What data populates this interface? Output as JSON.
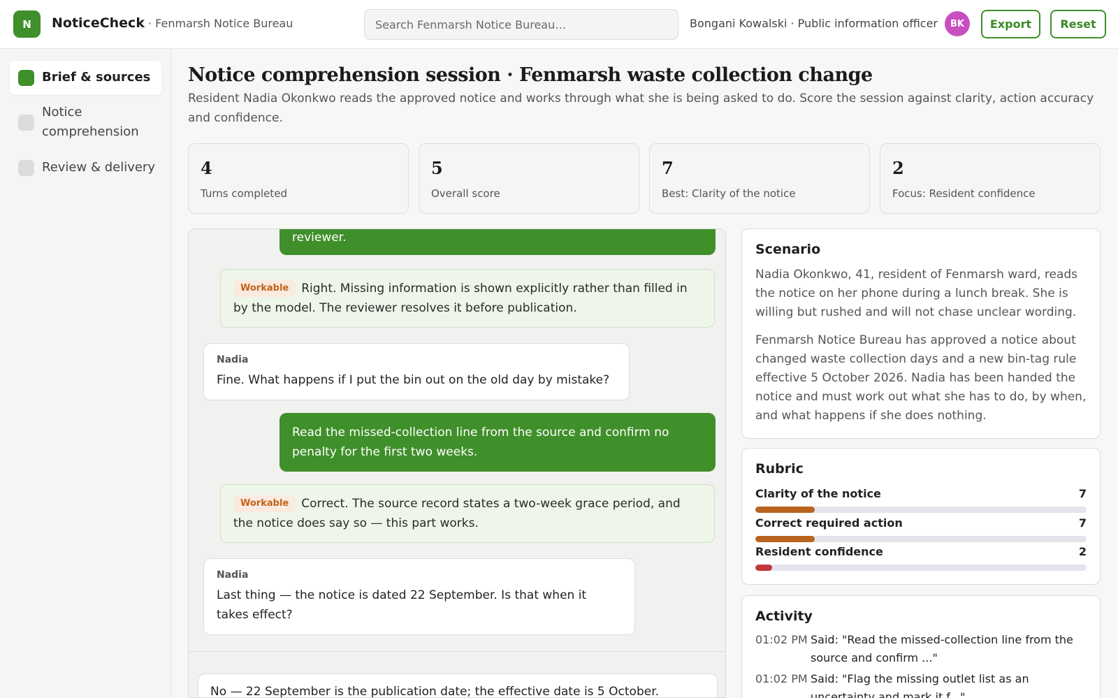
{
  "app": {
    "logo_letter": "N",
    "name": "NoticeCheck",
    "org": "· Fenmarsh Notice Bureau",
    "search_placeholder": "Search Fenmarsh Notice Bureau…",
    "user": "Bongani Kowalski · Public information officer",
    "avatar_initials": "BK",
    "export_label": "Export",
    "reset_label": "Reset",
    "colors": {
      "accent": "#3f8f2a",
      "avatar": "#c84fc0",
      "tag": "#c0641b",
      "bar_mid": "#b8641e",
      "bar_low": "#c1373a"
    }
  },
  "sidebar": {
    "items": [
      {
        "label": "Brief & sources",
        "active": true
      },
      {
        "label": "Notice comprehension",
        "active": false
      },
      {
        "label": "Review & delivery",
        "active": false
      }
    ]
  },
  "main": {
    "title": "Notice comprehension session · Fenmarsh waste collection change",
    "subtitle": "Resident Nadia Okonkwo reads the approved notice and works through what she is being asked to do. Score the session against clarity, action accuracy and confidence.",
    "stats": [
      {
        "value": "4",
        "label": "Turns completed"
      },
      {
        "value": "5",
        "label": "Overall score"
      },
      {
        "value": "7",
        "label": "Best: Clarity of the notice"
      },
      {
        "value": "2",
        "label": "Focus: Resident confidence"
      }
    ]
  },
  "chat": {
    "top_fragment": "reviewer.",
    "eval1_tag": "Workable",
    "eval1_text": "Right. Missing information is shown explicitly rather than filled in by the model. The reviewer resolves it before publication.",
    "res1_name": "Nadia",
    "res1_text": "Fine. What happens if I put the bin out on the old day by mistake?",
    "user2_text": "Read the missed-collection line from the source and confirm no penalty for the first two weeks.",
    "eval2_tag": "Workable",
    "eval2_text": "Correct. The source record states a two-week grace period, and the notice does say so — this part works.",
    "res2_name": "Nadia",
    "res2_text": "Last thing — the notice is dated 22 September. Is that when it takes effect?",
    "reply_text": "No — 22 September is the publication date; the effective date is 5 October."
  },
  "scenario": {
    "title": "Scenario",
    "p1": "Nadia Okonkwo, 41, resident of Fenmarsh ward, reads the notice on her phone during a lunch break. She is willing but rushed and will not chase unclear wording.",
    "p2": "Fenmarsh Notice Bureau has approved a notice about changed waste collection days and a new bin-tag rule effective 5 October 2026. Nadia has been handed the notice and must work out what she has to do, by when, and what happens if she does nothing."
  },
  "rubric": {
    "title": "Rubric",
    "items": [
      {
        "label": "Clarity of the notice",
        "value": "7",
        "fill_fraction": 0.18,
        "color": "#b8641e"
      },
      {
        "label": "Correct required action",
        "value": "7",
        "fill_fraction": 0.18,
        "color": "#b8641e"
      },
      {
        "label": "Resident confidence",
        "value": "2",
        "fill_fraction": 0.05,
        "color": "#c1373a"
      }
    ]
  },
  "activity": {
    "title": "Activity",
    "items": [
      {
        "time": "01:02 PM",
        "text": "Said: \"Read the missed-collection line from the source and confirm ...\""
      },
      {
        "time": "01:02 PM",
        "text": "Said: \"Flag the missing outlet list as an uncertainty and mark it f...\""
      }
    ]
  }
}
